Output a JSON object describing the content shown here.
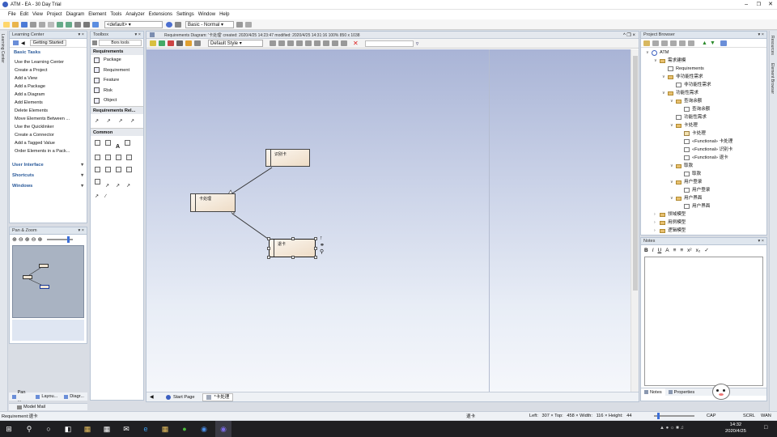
{
  "window": {
    "title": "ATM - EA - 30 Day Trial"
  },
  "menu": [
    "File",
    "Edit",
    "View",
    "Project",
    "Diagram",
    "Element",
    "Tools",
    "Analyzer",
    "Extensions",
    "Settings",
    "Window",
    "Help"
  ],
  "toolbar": {
    "perspective": "<default>",
    "workspace": "Basic - Normal"
  },
  "learning_center": {
    "title": "Learning Center",
    "tab": "Getting Started",
    "section": "Basic Tasks",
    "tasks": [
      "Use the Learning Center",
      "Create a Project",
      "Add a View",
      "Add a Package",
      "Add a Diagram",
      "Add Elements",
      "Delete Elements",
      "Move Elements Between ...",
      "Use the Quicklinker",
      "Create a Connector",
      "Add a Tagged Value",
      "Order Elements in a Pack..."
    ],
    "other_sections": [
      "User Interface",
      "Shortcuts",
      "Windows"
    ]
  },
  "pan_zoom": {
    "title": "Pan & Zoom"
  },
  "left_tabs": [
    "Pan ...",
    "Layou...",
    "Diagr..."
  ],
  "model_mail": "Model Mail",
  "toolbox": {
    "title": "Toolbox",
    "search": "Bors tools",
    "section1": "Requirements",
    "items": [
      "Package",
      "Requirement",
      "Feature",
      "Risk",
      "Object"
    ],
    "section2": "Requirements Rel...",
    "section3": "Common"
  },
  "diagram": {
    "header": "Requirements Diagram: '卡处理'   created: 2020/4/25 14:23:47  modified: 2020/4/25 14:31:16   100%   850 x 1038",
    "style": "Default Style",
    "nodes": {
      "top": "识别卡",
      "mid": "卡处理",
      "bottom": "退卡"
    },
    "tabs": [
      "Start Page",
      "*卡处理"
    ]
  },
  "project_browser": {
    "title": "Project Browser",
    "items": [
      {
        "label": "ATM",
        "indent": 0,
        "icon": "root",
        "toggle": "v"
      },
      {
        "label": "需求建模",
        "indent": 1,
        "icon": "folder",
        "toggle": "v"
      },
      {
        "label": "Requirements",
        "indent": 2,
        "icon": "elem",
        "toggle": ""
      },
      {
        "label": "非功能性需求",
        "indent": 2,
        "icon": "folder",
        "toggle": "v"
      },
      {
        "label": "非功能性需求",
        "indent": 3,
        "icon": "elem",
        "toggle": ""
      },
      {
        "label": "功能性需求",
        "indent": 2,
        "icon": "folder",
        "toggle": "v"
      },
      {
        "label": "查询余额",
        "indent": 3,
        "icon": "folder",
        "toggle": "v"
      },
      {
        "label": "查询余额",
        "indent": 4,
        "icon": "elem",
        "toggle": ""
      },
      {
        "label": "功能性需求",
        "indent": 3,
        "icon": "elem",
        "toggle": ""
      },
      {
        "label": "卡处理",
        "indent": 3,
        "icon": "folder",
        "toggle": "v"
      },
      {
        "label": "卡处理",
        "indent": 4,
        "icon": "pkg",
        "toggle": ""
      },
      {
        "label": "«Functional» 卡处理",
        "indent": 4,
        "icon": "elem",
        "toggle": ""
      },
      {
        "label": "«Functional» 识别卡",
        "indent": 4,
        "icon": "elem",
        "toggle": ""
      },
      {
        "label": "«Functional» 退卡",
        "indent": 4,
        "icon": "elem",
        "toggle": ""
      },
      {
        "label": "取款",
        "indent": 3,
        "icon": "folder",
        "toggle": "v"
      },
      {
        "label": "取款",
        "indent": 4,
        "icon": "elem",
        "toggle": ""
      },
      {
        "label": "用户登录",
        "indent": 3,
        "icon": "folder",
        "toggle": "v"
      },
      {
        "label": "用户登录",
        "indent": 4,
        "icon": "elem",
        "toggle": ""
      },
      {
        "label": "用户界面",
        "indent": 3,
        "icon": "folder",
        "toggle": "v"
      },
      {
        "label": "用户界面",
        "indent": 4,
        "icon": "elem",
        "toggle": ""
      },
      {
        "label": "领域模型",
        "indent": 1,
        "icon": "folder",
        "toggle": ">"
      },
      {
        "label": "用例模型",
        "indent": 1,
        "icon": "folder",
        "toggle": ">"
      },
      {
        "label": "逻辑模型",
        "indent": 1,
        "icon": "folder",
        "toggle": ">"
      }
    ]
  },
  "notes": {
    "title": "Notes",
    "tabs": [
      "Notes",
      "Properties"
    ]
  },
  "status": {
    "left": "Requirement:退卡",
    "center": "退卡",
    "geom": "Left:   307 × Top:   458 × Width:   116 × Height:   44",
    "caps": "CAP",
    "scrl": "SCRL",
    "wan": "WAN"
  },
  "taskbar": {
    "time": "14:32",
    "date": "2020/4/25"
  }
}
